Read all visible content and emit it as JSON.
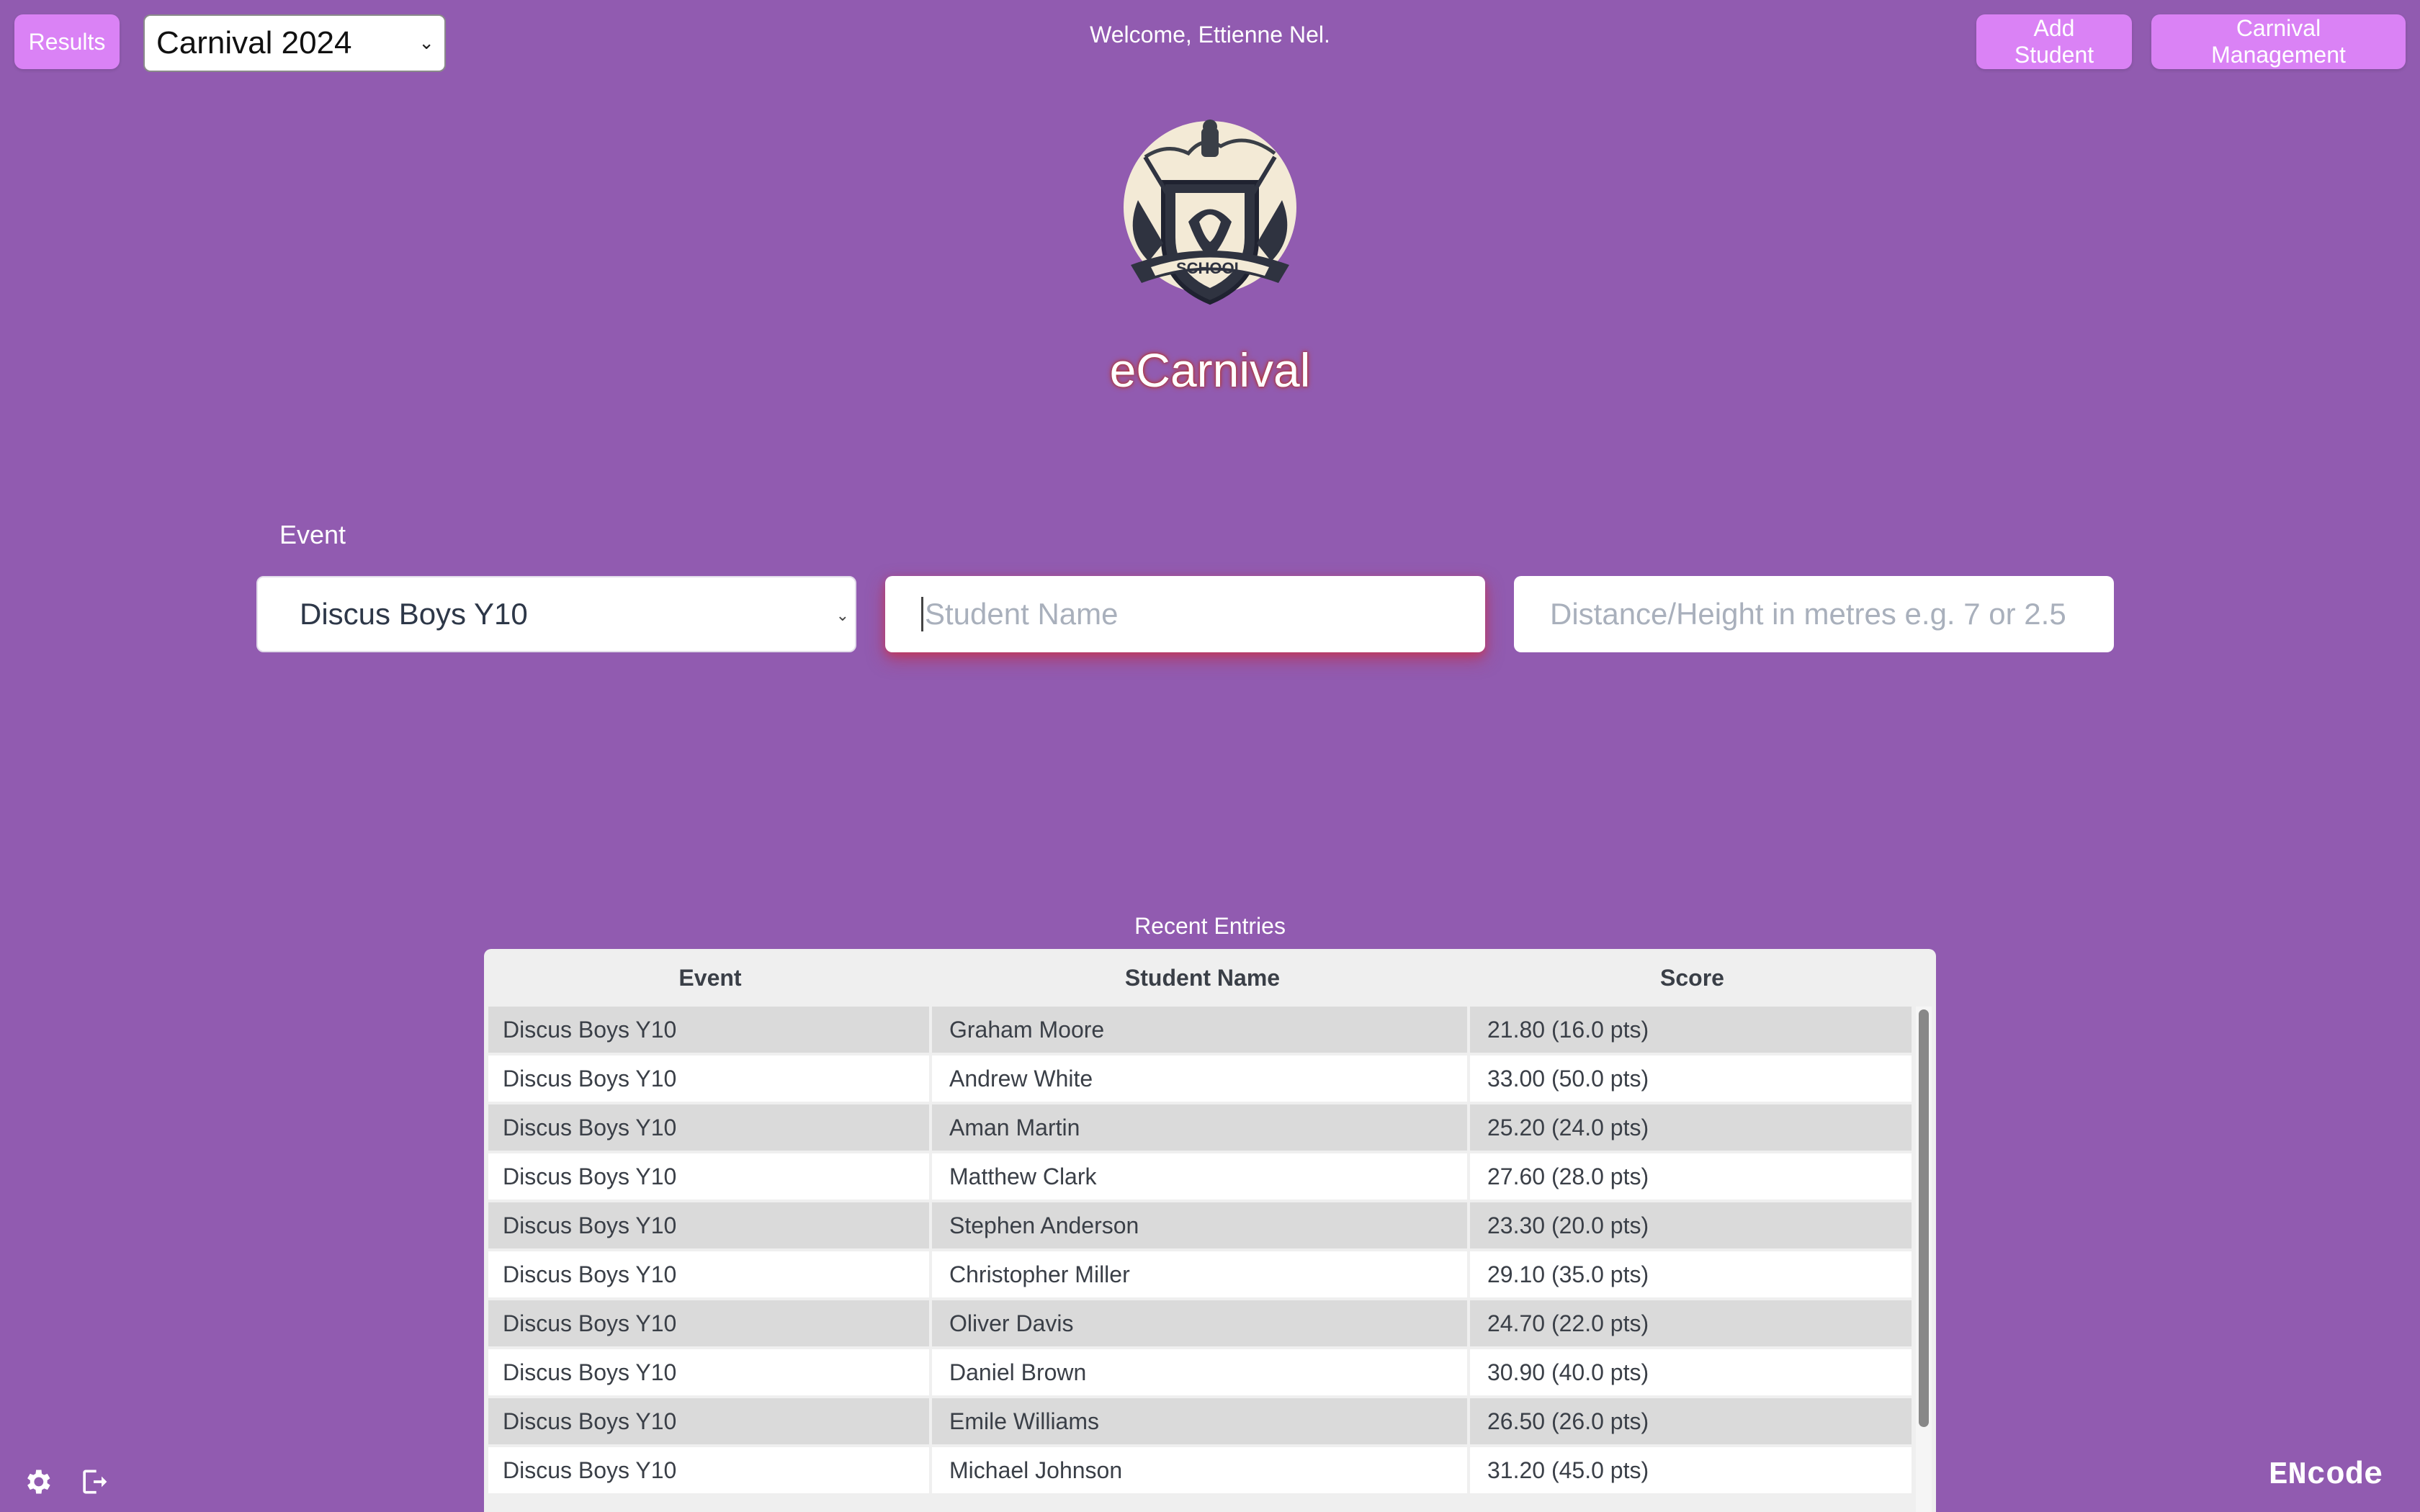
{
  "header": {
    "results_label": "Results",
    "carnival_selected": "Carnival 2024",
    "welcome_text": "Welcome, Ettienne Nel.",
    "add_student_label": "Add Student",
    "carnival_management_label": "Carnival Management"
  },
  "logo": {
    "text": "SCHOOL",
    "icon": "school-crest-logo"
  },
  "app": {
    "title": "eCarnival"
  },
  "form": {
    "event_label": "Event",
    "event_selected": "Discus Boys Y10",
    "student_placeholder": "Student Name",
    "distance_placeholder": "Distance/Height in metres e.g. 7 or 2.5"
  },
  "recent": {
    "title": "Recent Entries",
    "columns": [
      "Event",
      "Student Name",
      "Score"
    ],
    "rows": [
      {
        "event": "Discus Boys Y10",
        "student": "Graham Moore",
        "score": "21.80 (16.0 pts)"
      },
      {
        "event": "Discus Boys Y10",
        "student": "Andrew White",
        "score": "33.00 (50.0 pts)"
      },
      {
        "event": "Discus Boys Y10",
        "student": "Aman Martin",
        "score": "25.20 (24.0 pts)"
      },
      {
        "event": "Discus Boys Y10",
        "student": "Matthew Clark",
        "score": "27.60 (28.0 pts)"
      },
      {
        "event": "Discus Boys Y10",
        "student": "Stephen Anderson",
        "score": "23.30 (20.0 pts)"
      },
      {
        "event": "Discus Boys Y10",
        "student": "Christopher Miller",
        "score": "29.10 (35.0 pts)"
      },
      {
        "event": "Discus Boys Y10",
        "student": "Oliver Davis",
        "score": "24.70 (22.0 pts)"
      },
      {
        "event": "Discus Boys Y10",
        "student": "Daniel Brown",
        "score": "30.90 (40.0 pts)"
      },
      {
        "event": "Discus Boys Y10",
        "student": "Emile Williams",
        "score": "26.50 (26.0 pts)"
      },
      {
        "event": "Discus Boys Y10",
        "student": "Michael Johnson",
        "score": "31.20 (45.0 pts)"
      }
    ]
  },
  "footer": {
    "brand": "ENcode",
    "settings_icon": "gear-icon",
    "logout_icon": "logout-icon"
  },
  "colors": {
    "background": "#915bb0",
    "button": "#da82f5",
    "title_glow": "#c0392b"
  }
}
